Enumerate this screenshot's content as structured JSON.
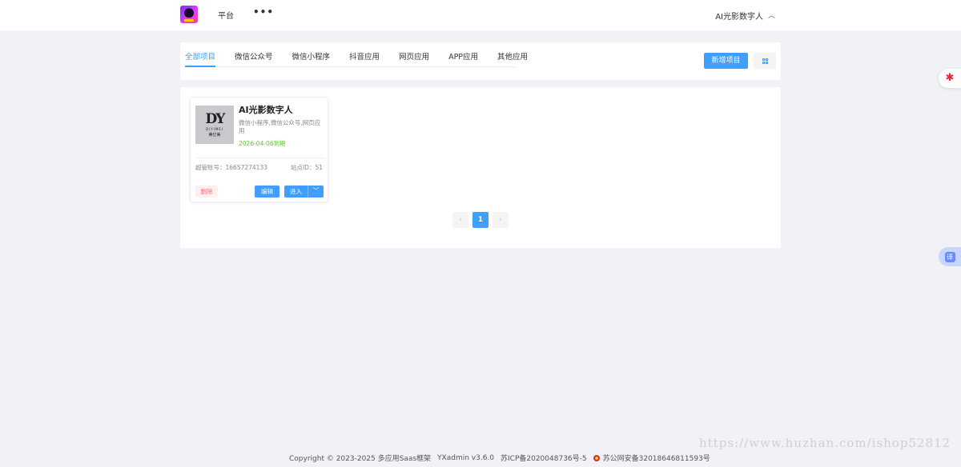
{
  "header": {
    "platform_label": "平台",
    "more_label": "•••",
    "user_label": "AI光影数字人"
  },
  "tabs": [
    {
      "label": "全部项目",
      "active": true
    },
    {
      "label": "微信公众号"
    },
    {
      "label": "微信小程序"
    },
    {
      "label": "抖音应用"
    },
    {
      "label": "网页应用"
    },
    {
      "label": "APP应用"
    },
    {
      "label": "其他应用"
    }
  ],
  "toolbar": {
    "add_label": "新增项目"
  },
  "project_card": {
    "title": "AI光影数字人",
    "logo_mark": "DY",
    "logo_sub": "DIYIMEI",
    "logo_cn": "蒂亿美",
    "tags": "微信小程序,微信公众号,网页应用",
    "expire": "2026-04-06到期",
    "account": "超管账号：16657274133",
    "site": "站点ID：51",
    "delete_label": "删除",
    "edit_label": "编辑",
    "enter_label": "进入",
    "enter_dropdown": "﹀"
  },
  "pagination": {
    "prev": "‹",
    "current": "1",
    "next": "›"
  },
  "side": {
    "star": "✱",
    "translate": "译"
  },
  "footer": {
    "copyright": "Copyright © 2023-2025 多应用Saas框架",
    "version": "YXadmin v3.6.0",
    "icp": "苏ICP备2020048736号-5",
    "police": "苏公网安备32018646811593号"
  },
  "watermark": "https://www.huzhan.com/ishop52812",
  "colors": {
    "primary": "#409eff",
    "danger": "#f56c6c",
    "success": "#67c23a",
    "page_bg": "#f1f2f5"
  }
}
